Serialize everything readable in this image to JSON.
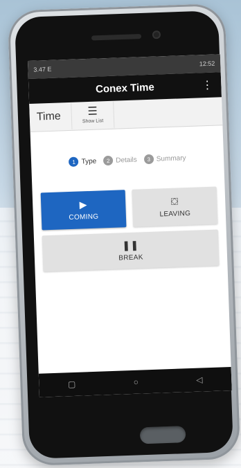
{
  "status_bar": {
    "left": "3.47 E",
    "right": "12:52"
  },
  "app_bar": {
    "title": "Conex Time",
    "menu_icon": "more-vert-icon"
  },
  "toolbar": {
    "label": "Time",
    "show_list": "Show List"
  },
  "steps": [
    {
      "num": "1",
      "label": "Type",
      "active": true
    },
    {
      "num": "2",
      "label": "Details",
      "active": false
    },
    {
      "num": "3",
      "label": "Summary",
      "active": false
    }
  ],
  "actions": {
    "coming": "COMING",
    "leaving": "LEAVING",
    "break": "BREAK"
  },
  "nav": {
    "square": "▢",
    "circle": "○",
    "back": "◁"
  },
  "colors": {
    "accent": "#1e66c1",
    "appbar": "#111111",
    "button_bg": "#e1e1e1"
  }
}
